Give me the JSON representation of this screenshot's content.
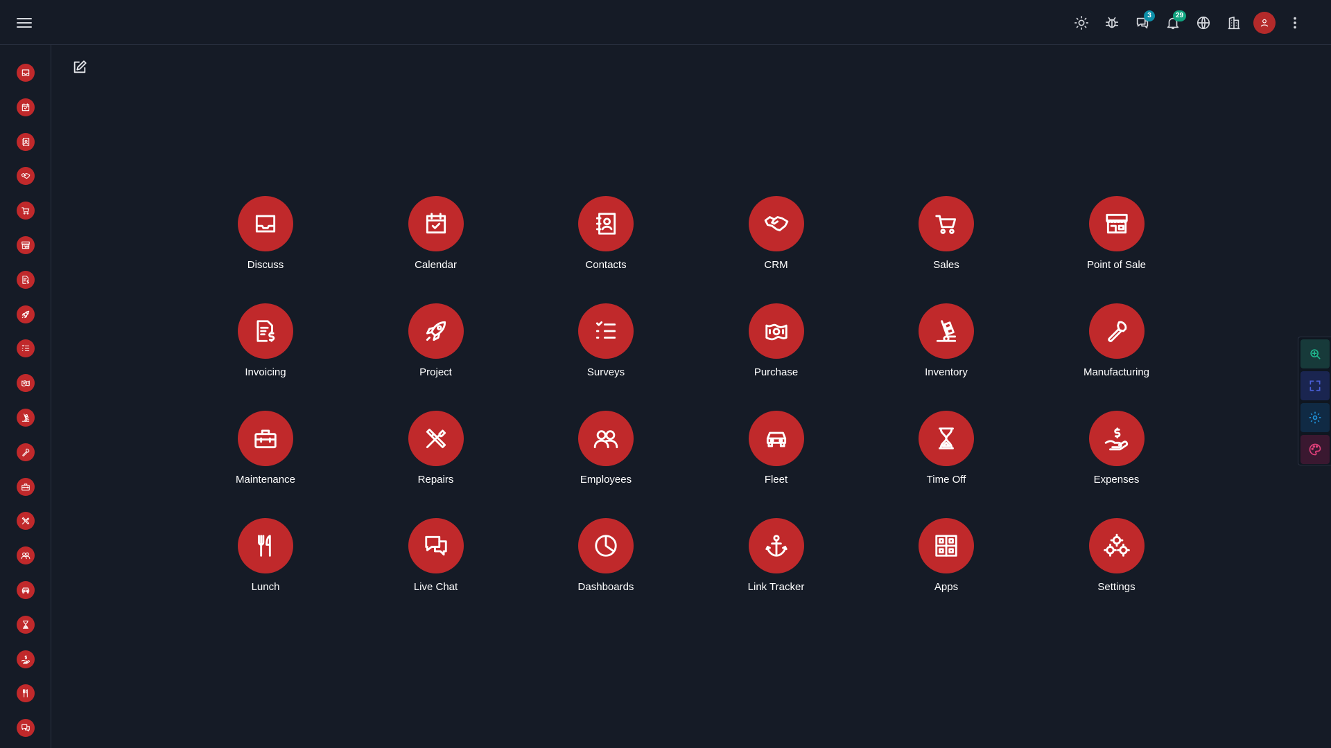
{
  "topbar": {
    "chat_badge": "3",
    "notifications_badge": "29"
  },
  "apps": [
    {
      "label": "Discuss",
      "icon": "inbox-icon"
    },
    {
      "label": "Calendar",
      "icon": "calendar-check-icon"
    },
    {
      "label": "Contacts",
      "icon": "address-book-icon"
    },
    {
      "label": "CRM",
      "icon": "handshake-icon"
    },
    {
      "label": "Sales",
      "icon": "shopping-cart-icon"
    },
    {
      "label": "Point of Sale",
      "icon": "store-icon"
    },
    {
      "label": "Invoicing",
      "icon": "invoice-dollar-icon"
    },
    {
      "label": "Project",
      "icon": "rocket-icon"
    },
    {
      "label": "Surveys",
      "icon": "checklist-icon"
    },
    {
      "label": "Purchase",
      "icon": "banknote-icon"
    },
    {
      "label": "Inventory",
      "icon": "hand-truck-icon"
    },
    {
      "label": "Manufacturing",
      "icon": "wrench-icon"
    },
    {
      "label": "Maintenance",
      "icon": "toolbox-icon"
    },
    {
      "label": "Repairs",
      "icon": "tools-icon"
    },
    {
      "label": "Employees",
      "icon": "users-icon"
    },
    {
      "label": "Fleet",
      "icon": "car-icon"
    },
    {
      "label": "Time Off",
      "icon": "hourglass-icon"
    },
    {
      "label": "Expenses",
      "icon": "hand-dollar-icon"
    },
    {
      "label": "Lunch",
      "icon": "utensils-icon"
    },
    {
      "label": "Live Chat",
      "icon": "chat-bubbles-icon"
    },
    {
      "label": "Dashboards",
      "icon": "pie-chart-icon"
    },
    {
      "label": "Link Tracker",
      "icon": "anchor-icon"
    },
    {
      "label": "Apps",
      "icon": "grid-icon"
    },
    {
      "label": "Settings",
      "icon": "gears-icon"
    }
  ],
  "colors": {
    "background": "#151b26",
    "accent": "#c0292b",
    "chat_badge": "#0d8fa8",
    "notification_badge": "#10a37f"
  }
}
